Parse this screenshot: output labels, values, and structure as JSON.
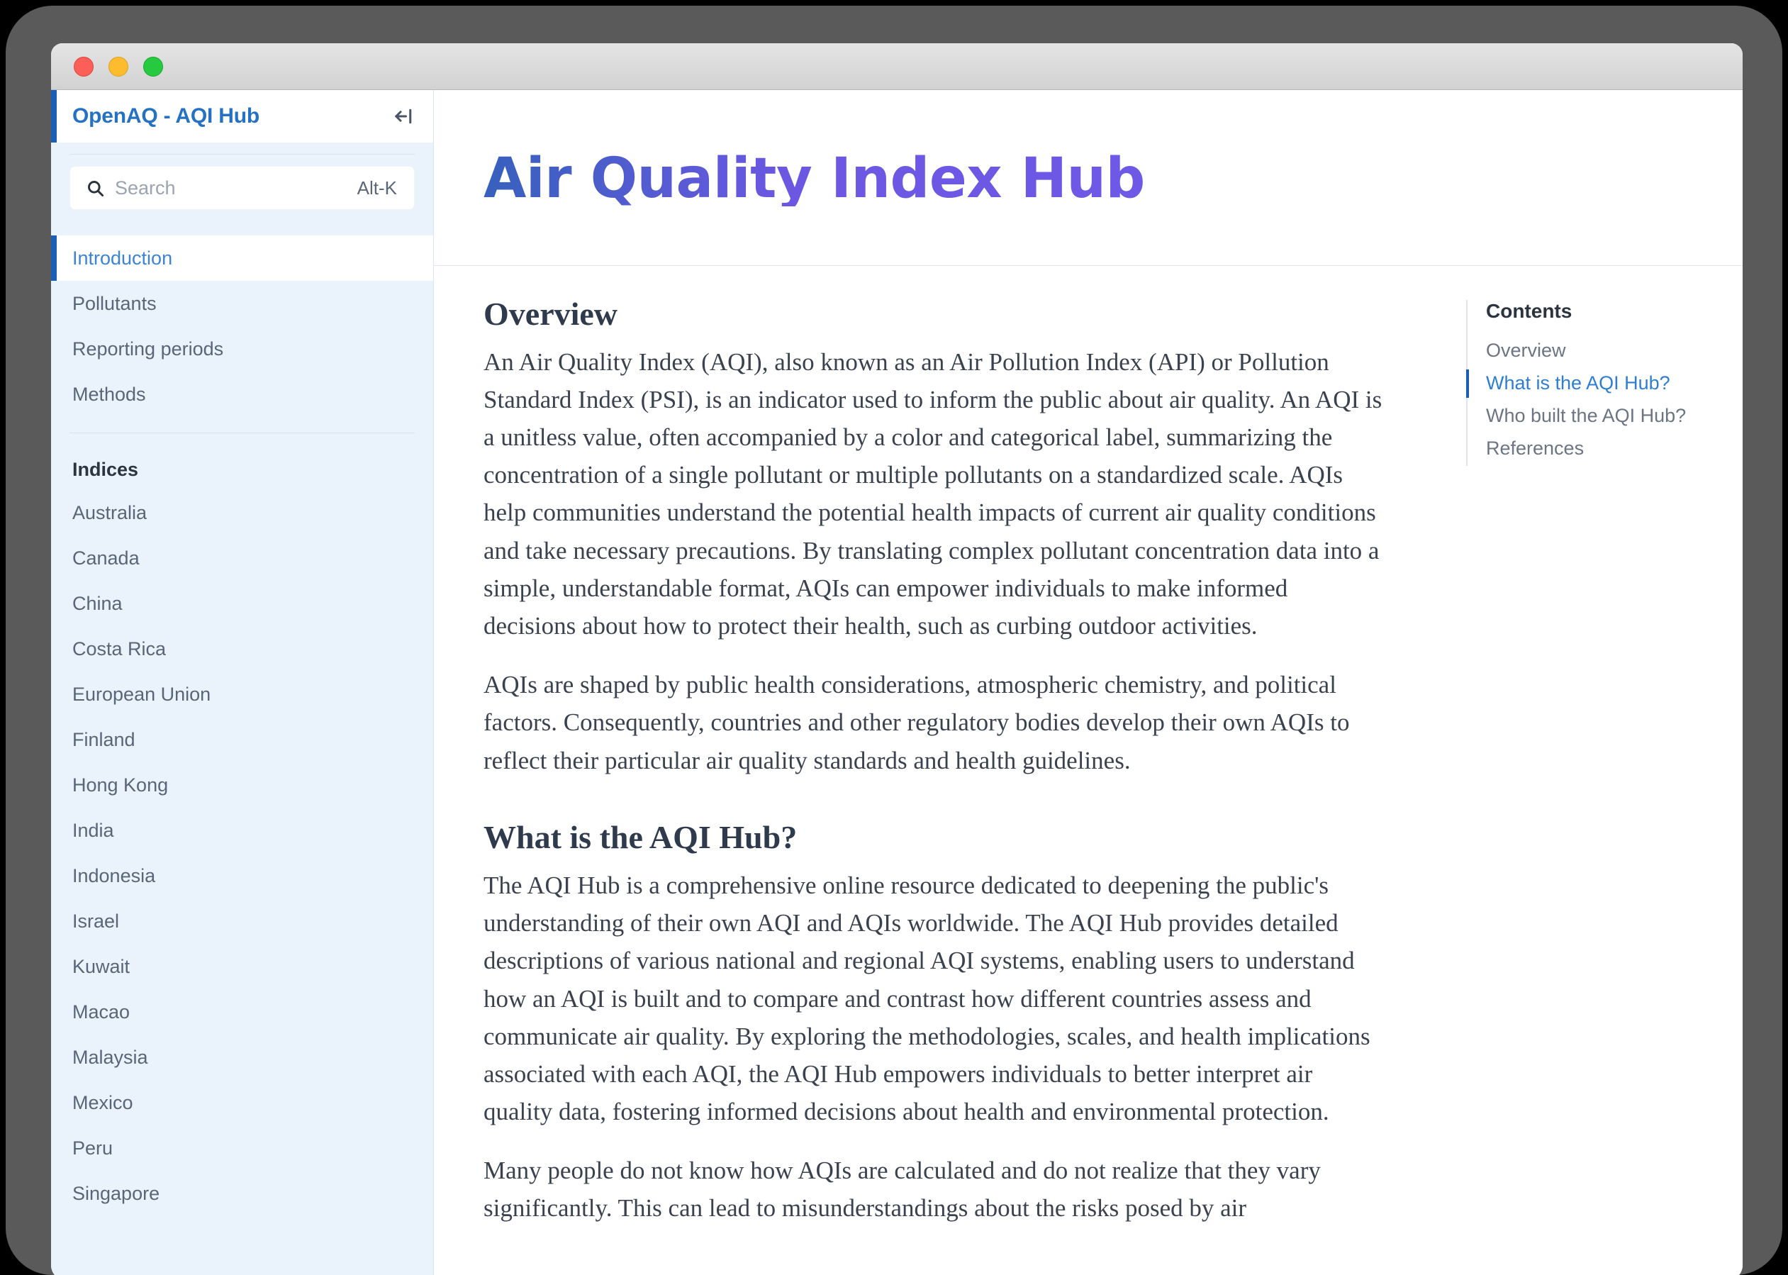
{
  "window": {
    "traffic_lights": [
      "close",
      "minimize",
      "maximize"
    ]
  },
  "sidebar": {
    "brand_title": "OpenAQ - AQI Hub",
    "collapse_icon": "collapse-sidebar-icon",
    "search": {
      "icon": "search-icon",
      "placeholder": "Search",
      "shortcut": "Alt-K"
    },
    "top_items": [
      {
        "label": "Introduction",
        "active": true
      },
      {
        "label": "Pollutants",
        "active": false
      },
      {
        "label": "Reporting periods",
        "active": false
      },
      {
        "label": "Methods",
        "active": false
      }
    ],
    "group_title": "Indices",
    "indices": [
      {
        "label": "Australia"
      },
      {
        "label": "Canada"
      },
      {
        "label": "China"
      },
      {
        "label": "Costa Rica"
      },
      {
        "label": "European Union"
      },
      {
        "label": "Finland"
      },
      {
        "label": "Hong Kong"
      },
      {
        "label": "India"
      },
      {
        "label": "Indonesia"
      },
      {
        "label": "Israel"
      },
      {
        "label": "Kuwait"
      },
      {
        "label": "Macao"
      },
      {
        "label": "Malaysia"
      },
      {
        "label": "Mexico"
      },
      {
        "label": "Peru"
      },
      {
        "label": "Singapore"
      }
    ]
  },
  "page": {
    "title": "Air Quality Index Hub",
    "sections": [
      {
        "heading": "Overview",
        "paragraphs": [
          "An Air Quality Index (AQI), also known as an Air Pollution Index (API) or Pollution Standard Index (PSI), is an indicator used to inform the public about air quality. An AQI is a unitless value, often accompanied by a color and categorical label, summarizing the concentration of a single pollutant or multiple pollutants on a standardized scale. AQIs help communities understand the potential health impacts of current air quality conditions and take necessary precautions. By translating complex pollutant concentration data into a simple, understandable format, AQIs can empower individuals to make informed decisions about how to protect their health, such as curbing outdoor activities.",
          "AQIs are shaped by public health considerations, atmospheric chemistry, and political factors. Consequently, countries and other regulatory bodies develop their own AQIs to reflect their particular air quality standards and health guidelines."
        ]
      },
      {
        "heading": "What is the AQI Hub?",
        "paragraphs": [
          "The AQI Hub is a comprehensive online resource dedicated to deepening the public's understanding of their own AQI and AQIs worldwide. The AQI Hub provides detailed descriptions of various national and regional AQI systems, enabling users to understand how an AQI is built and to compare and contrast how different countries assess and communicate air quality. By exploring the methodologies, scales, and health implications associated with each AQI, the AQI Hub empowers individuals to better interpret air quality data, fostering informed decisions about health and environmental protection.",
          "Many people do not know how AQIs are calculated and do not realize that they vary significantly. This can lead to misunderstandings about the risks posed by air"
        ]
      }
    ]
  },
  "toc": {
    "title": "Contents",
    "items": [
      {
        "label": "Overview",
        "active": false
      },
      {
        "label": "What is the AQI Hub?",
        "active": true
      },
      {
        "label": "Who built the AQI Hub?",
        "active": false
      },
      {
        "label": "References",
        "active": false
      }
    ]
  },
  "colors": {
    "accent_blue": "#1a5fb4",
    "link_blue": "#3d84d6",
    "sidebar_bg": "#eaf2fc",
    "title_gradient_start": "#3761bd",
    "title_gradient_end": "#6e59e6"
  }
}
